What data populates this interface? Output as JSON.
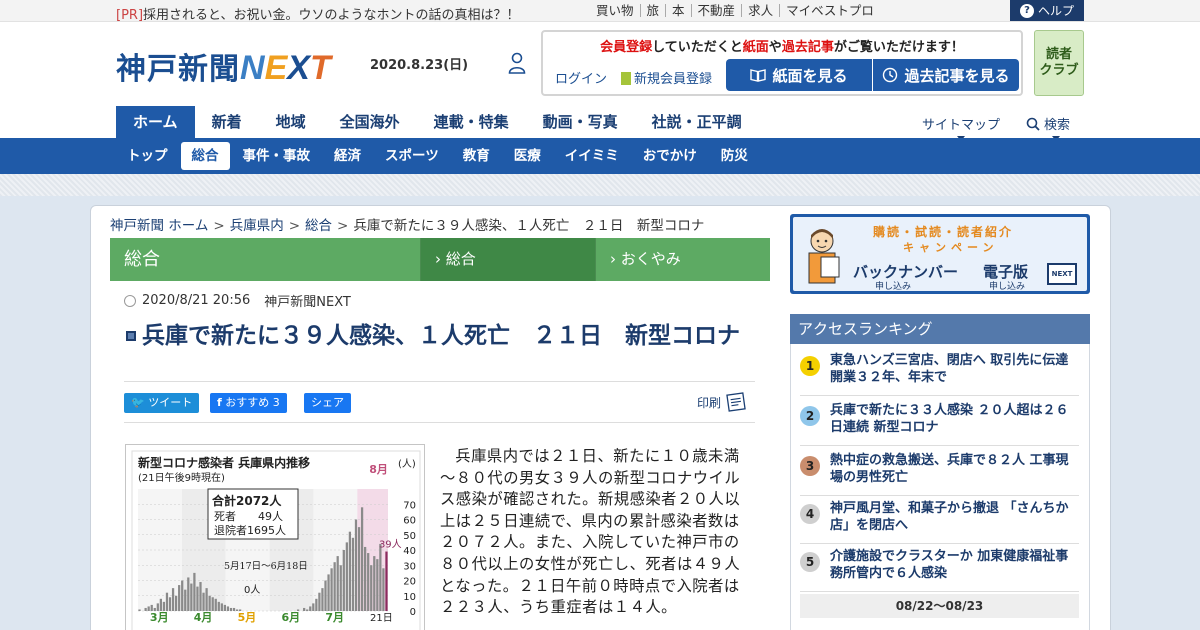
{
  "topbar": {
    "pr_tag": "[PR]",
    "pr_text": "採用されると、お祝い金。ウソのようなホントの話の真相は？！",
    "links": [
      "買い物",
      "旅",
      "本",
      "不動産",
      "求人",
      "マイベストプロ"
    ],
    "help_label": "ヘルプ"
  },
  "header": {
    "logo_kanji": "神戸新聞",
    "logo_n": "N",
    "logo_e": "E",
    "logo_x": "X",
    "logo_t": "T",
    "date": "2020.8.23(日)",
    "member_msg_1": "会員登録",
    "member_msg_2": "していただくと",
    "member_msg_3": "紙面",
    "member_msg_4": "や",
    "member_msg_5": "過去記事",
    "member_msg_6": "がご覧いただけます！",
    "login": "ログイン",
    "register": "新規会員登録",
    "btn_paper": "紙面を見る",
    "btn_past": "過去記事を見る",
    "readers_club_1": "読者",
    "readers_club_2": "クラブ"
  },
  "mainnav": [
    "ホーム",
    "新着",
    "地域",
    "全国海外",
    "連載・特集",
    "動画・写真",
    "社説・正平調"
  ],
  "mainnav_right": {
    "sitemap": "サイトマップ",
    "search": "検索"
  },
  "subnav": [
    "トップ",
    "総合",
    "事件・事故",
    "経済",
    "スポーツ",
    "教育",
    "医療",
    "イイミミ",
    "おでかけ",
    "防災"
  ],
  "breadcrumb": [
    "神戸新聞 ホーム",
    "兵庫県内",
    "総合",
    "兵庫で新たに３９人感染、１人死亡　２１日　新型コロナ"
  ],
  "category_bar": {
    "main": "総合",
    "tab1": "総合",
    "tab2": "おくやみ"
  },
  "article": {
    "datetime": "2020/8/21 20:56",
    "source": "神戸新聞NEXT",
    "title": "兵庫で新たに３９人感染、１人死亡　２１日　新型コロナ",
    "tweet": "ツイート",
    "recommend": "おすすめ 3",
    "share": "シェア",
    "print": "印刷",
    "body": "兵庫県内では２１日、新たに１０歳未満～８０代の男女３９人の新型コロナウイルス感染が確認された。新規感染者２０人以上は２５日連続で、県内の累計感染者数は２０７２人。また、入院していた神戸市の８０代以上の女性が死亡し、死者は４９人となった。２１日午前０時時点で入院者は２２３人、うち重症者は１４人。"
  },
  "chart_data": {
    "type": "bar",
    "title": "新型コロナ感染者 兵庫県内推移",
    "subtitle": "(21日午後9時現在)",
    "ylabel": "(人)",
    "ylim": [
      0,
      80
    ],
    "yticks": [
      0,
      10,
      20,
      30,
      40,
      50,
      60,
      70
    ],
    "month_labels": [
      "3月",
      "4月",
      "5月",
      "6月",
      "7月",
      "8月"
    ],
    "end_label": "21日",
    "summary": {
      "total": "合計2072人",
      "deaths": "死者　　49人",
      "discharged": "退院者1695人"
    },
    "annotation": "5月17日～6月18日",
    "annotation_value": "0人",
    "last_value_label": "39人",
    "series": [
      {
        "values": [
          1,
          0,
          2,
          3,
          4,
          2,
          5,
          8,
          6,
          12,
          9,
          15,
          10,
          17,
          20,
          14,
          22,
          18,
          25,
          16,
          19,
          12,
          15,
          10,
          9,
          8,
          6,
          5,
          4,
          3,
          2,
          2,
          1,
          1,
          0,
          0,
          0,
          0,
          0,
          0,
          0,
          0,
          0,
          0,
          0,
          0,
          0,
          0,
          0,
          0,
          0,
          0,
          1,
          0,
          2,
          1,
          3,
          5,
          8,
          12,
          15,
          20,
          24,
          28,
          32,
          36,
          30,
          40,
          45,
          52,
          48,
          60,
          55,
          68,
          42,
          38,
          30,
          36,
          34,
          44,
          28,
          39
        ]
      }
    ]
  },
  "sidebar": {
    "banner": {
      "title": "購読・試読・読者紹介",
      "campaign": "キャンペーン",
      "btn1": "バックナンバー",
      "btn1_sub": "申し込み",
      "btn2": "電子版",
      "btn2_sub": "申し込み",
      "icon_text": "NEXT"
    },
    "ranking_title": "アクセスランキング",
    "ranking": [
      {
        "num": "1",
        "text": "東急ハンズ三宮店、閉店へ 取引先に伝達 開業３２年、年末で",
        "color": "#f4d000"
      },
      {
        "num": "2",
        "text": "兵庫で新たに３３人感染 ２０人超は２６日連続 新型コロナ",
        "color": "#8fc6ea"
      },
      {
        "num": "3",
        "text": "熱中症の救急搬送、兵庫で８２人 工事現場の男性死亡",
        "color": "#c98d6d"
      },
      {
        "num": "4",
        "text": "神戸風月堂、和菓子から撤退 「さんちか店」を閉店へ",
        "color": "#cfcfcf"
      },
      {
        "num": "5",
        "text": "介護施設でクラスターか 加東健康福祉事務所管内で６人感染",
        "color": "#cfcfcf"
      }
    ],
    "ranking_date": "08/22～08/23"
  }
}
